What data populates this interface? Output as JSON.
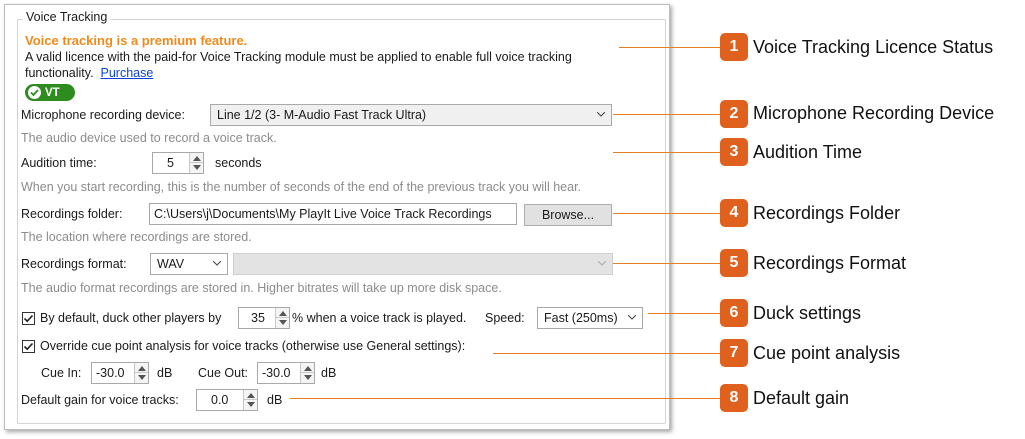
{
  "group_title": "Voice Tracking",
  "premium_notice": "Voice tracking is a premium feature.",
  "licence_text": "A valid licence with the paid-for Voice Tracking module must be applied to enable full voice tracking functionality.",
  "purchase_link": "Purchase",
  "vt_badge": "VT",
  "microphone": {
    "label": "Microphone recording device:",
    "value": "Line 1/2 (3- M-Audio Fast Track Ultra)",
    "hint": "The audio device used to record a voice track."
  },
  "audition": {
    "label": "Audition time:",
    "value": "5",
    "unit": "seconds",
    "hint": "When you start recording, this is the number of seconds of the end of the previous track you will hear."
  },
  "folder": {
    "label": "Recordings folder:",
    "value": "C:\\Users\\j\\Documents\\My PlayIt Live Voice Track Recordings",
    "browse": "Browse...",
    "hint": "The location where recordings are stored."
  },
  "format": {
    "label": "Recordings format:",
    "value": "WAV",
    "bitrate": "",
    "hint": "The audio format recordings are stored in. Higher bitrates will take up more disk space."
  },
  "duck": {
    "checked": true,
    "label_pre": "By default, duck other players by",
    "value": "35",
    "label_post": "% when a voice track is played.",
    "speed_label": "Speed:",
    "speed_value": "Fast (250ms)"
  },
  "cue": {
    "checked": true,
    "label": "Override cue point analysis for voice tracks (otherwise use General settings):",
    "in_label": "Cue In:",
    "in_value": "-30.0",
    "in_unit": "dB",
    "out_label": "Cue Out:",
    "out_value": "-30.0",
    "out_unit": "dB"
  },
  "gain": {
    "label": "Default gain for voice tracks:",
    "value": "0.0",
    "unit": "dB"
  },
  "callouts": [
    {
      "num": "1",
      "label": "Voice Tracking Licence Status"
    },
    {
      "num": "2",
      "label": "Microphone Recording Device"
    },
    {
      "num": "3",
      "label": "Audition Time"
    },
    {
      "num": "4",
      "label": "Recordings Folder"
    },
    {
      "num": "5",
      "label": "Recordings Format"
    },
    {
      "num": "6",
      "label": "Duck settings"
    },
    {
      "num": "7",
      "label": "Cue point analysis"
    },
    {
      "num": "8",
      "label": "Default gain"
    }
  ],
  "colors": {
    "premium": "#f08a1c",
    "callout": "#e0601e",
    "badge": "#2e8b1f",
    "link": "#0b44d6"
  }
}
